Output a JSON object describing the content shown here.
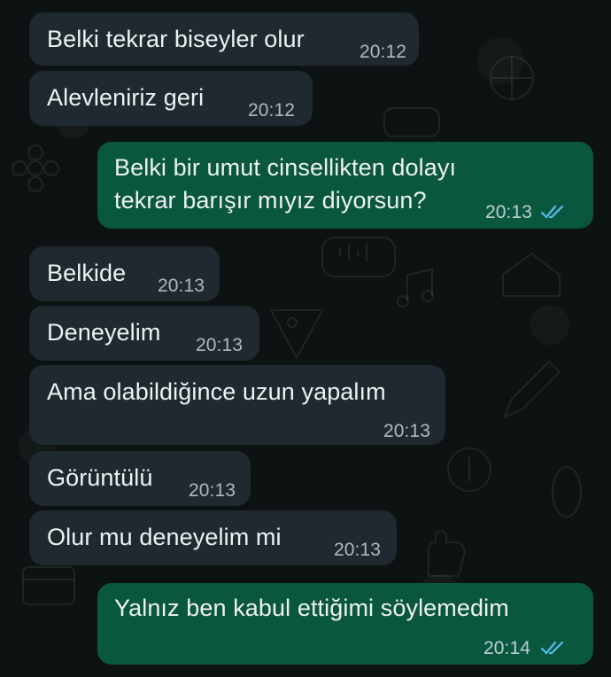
{
  "messages": [
    {
      "direction": "incoming",
      "text": "Belki tekrar biseyler olur",
      "time": "20:12"
    },
    {
      "direction": "incoming",
      "text": "Alevleniriz geri",
      "time": "20:12"
    },
    {
      "direction": "outgoing",
      "text_lines": [
        "Belki bir umut cinsellikten dolayı",
        "tekrar barışır mıyız diyorsun?"
      ],
      "time": "20:13",
      "status": "read",
      "status_icon": "double-check-icon"
    },
    {
      "direction": "incoming",
      "text": "Belkide",
      "time": "20:13"
    },
    {
      "direction": "incoming",
      "text": "Deneyelim",
      "time": "20:13"
    },
    {
      "direction": "incoming",
      "text": "Ama olabildiğince uzun yapalım",
      "time": "20:13"
    },
    {
      "direction": "incoming",
      "text": "Görüntülü",
      "time": "20:13"
    },
    {
      "direction": "incoming",
      "text": "Olur mu deneyelim mi",
      "time": "20:13"
    },
    {
      "direction": "outgoing",
      "text": "Yalnız ben kabul ettiğimi söylemedim",
      "time": "20:14",
      "status": "read",
      "status_icon": "double-check-icon"
    }
  ],
  "colors": {
    "incoming_bubble": "#1f2a30",
    "outgoing_bubble": "#0a5740",
    "read_tick": "#53bdeb",
    "background": "#0d1212"
  }
}
